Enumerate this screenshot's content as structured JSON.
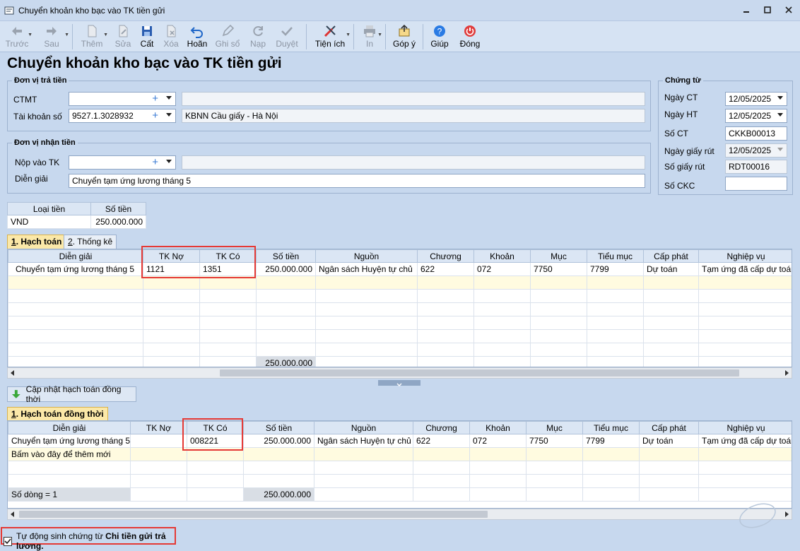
{
  "window": {
    "title": "Chuyển khoản kho bạc vào TK tiền gửi",
    "minimize_icon": "minimize-icon",
    "maximize_icon": "maximize-icon",
    "close_icon": "close-icon"
  },
  "toolbar": {
    "prev": "Trước",
    "next": "Sau",
    "add": "Thêm",
    "edit": "Sửa",
    "save": "Cất",
    "delete": "Xóa",
    "undo": "Hoãn",
    "post": "Ghi sổ",
    "load": "Nạp",
    "approve": "Duyệt",
    "utility": "Tiện ích",
    "print": "In",
    "feedback": "Góp ý",
    "help": "Giúp",
    "close": "Đóng"
  },
  "page_title": "Chuyển khoản kho bạc vào TK tiền gửi",
  "payer": {
    "legend": "Đơn vị trả tiền",
    "ctmt_label": "CTMT",
    "ctmt_value": "",
    "ctmt_desc": "",
    "account_label": "Tài khoản số",
    "account_value": "9527.1.3028932",
    "account_desc": "KBNN Cầu giấy - Hà Nội"
  },
  "payee": {
    "legend": "Đơn vị nhận tiền",
    "deposit_label": "Nộp vào TK",
    "deposit_value": "",
    "deposit_desc": "",
    "desc_label": "Diễn giải",
    "desc_value": "Chuyển tạm ứng lương tháng 5"
  },
  "voucher": {
    "legend": "Chứng từ",
    "date_ct_label": "Ngày CT",
    "date_ct": "12/05/2025",
    "date_ht_label": "Ngày HT",
    "date_ht": "12/05/2025",
    "so_ct_label": "Số CT",
    "so_ct": "CKKB00013",
    "date_rut_label": "Ngày giấy rút",
    "date_rut": "12/05/2025",
    "so_rut_label": "Số giấy rút",
    "so_rut": "RDT00016",
    "so_ckc_label": "Số CKC",
    "so_ckc": ""
  },
  "currency": {
    "h1": "Loại tiền",
    "h2": "Số tiền",
    "type": "VND",
    "amount": "250.000.000"
  },
  "tabs1": {
    "t1_num": "1",
    "t1": ". Hạch toán",
    "t2_num": "2",
    "t2": ". Thống kê"
  },
  "grid1": {
    "headers": [
      "Diễn giải",
      "TK Nợ",
      "TK Có",
      "Số tiền",
      "Nguồn",
      "Chương",
      "Khoản",
      "Mục",
      "Tiểu mục",
      "Cấp phát",
      "Nghiệp vụ"
    ],
    "row": [
      "Chuyển tạm ứng lương tháng 5",
      "1121",
      "1351",
      "250.000.000",
      "Ngân sách Huyện tự chủ",
      "622",
      "072",
      "7750",
      "7799",
      "Dự toán",
      "Tạm ứng đã cấp dự toán"
    ],
    "total": "250.000.000"
  },
  "update_button": "Cập nhật hạch toán đồng thời",
  "tabs2": {
    "t1_num": "1",
    "t1": ". Hạch toán đồng thời"
  },
  "grid2": {
    "headers": [
      "Diễn giải",
      "TK Nợ",
      "TK Có",
      "Số tiền",
      "Nguồn",
      "Chương",
      "Khoản",
      "Mục",
      "Tiểu mục",
      "Cấp phát",
      "Nghiệp vụ"
    ],
    "row": [
      "Chuyển tạm ứng lương tháng 5",
      "",
      "008221",
      "250.000.000",
      "Ngân sách Huyện tự chủ",
      "622",
      "072",
      "7750",
      "7799",
      "Dự toán",
      "Tạm ứng đã cấp dự toán"
    ],
    "add_new": "Bấm vào đây để thêm mới",
    "row_count": "Số dòng = 1",
    "total": "250.000.000"
  },
  "footer": {
    "auto_prefix": "Tự động sinh chứng từ ",
    "auto_bold": "Chi tiền gửi trả lương."
  }
}
